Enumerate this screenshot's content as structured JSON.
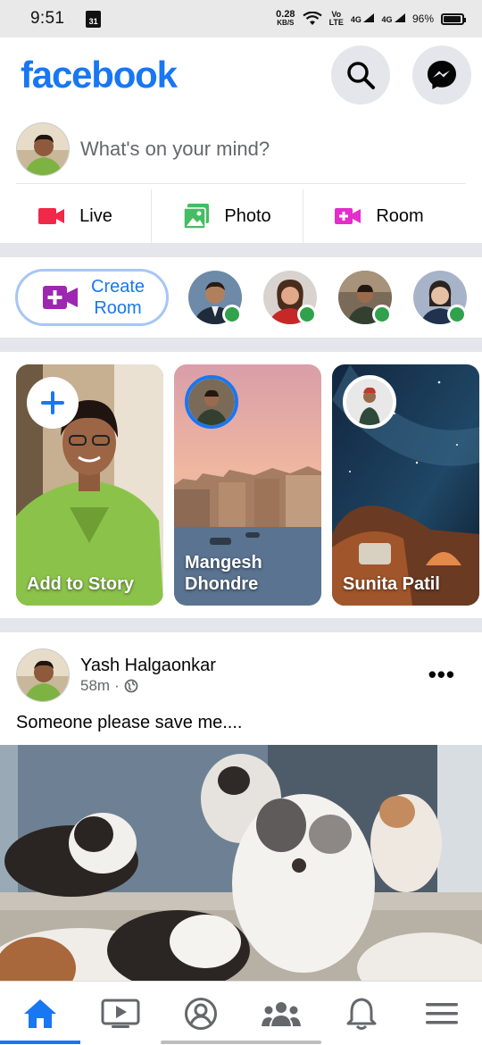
{
  "status_bar": {
    "time": "9:51",
    "calendar_day": "31",
    "net_speed": "0.28",
    "net_unit": "KB/S",
    "volte": "Vo\nLTE",
    "signal1": "4G",
    "signal2": "4G",
    "battery": "96%"
  },
  "header": {
    "logo": "facebook",
    "search_icon": "search-icon",
    "messenger_icon": "messenger-icon"
  },
  "composer": {
    "placeholder": "What's on your mind?"
  },
  "actions": [
    {
      "label": "Live",
      "icon": "video-camera-icon",
      "color": "#f02849"
    },
    {
      "label": "Photo",
      "icon": "photo-icon",
      "color": "#45bd62"
    },
    {
      "label": "Room",
      "icon": "video-plus-icon",
      "color": "#e42dcb"
    }
  ],
  "rooms": {
    "create_label": "Create\nRoom"
  },
  "stories": [
    {
      "label": "Add to Story"
    },
    {
      "label": "Mangesh\nDhondre"
    },
    {
      "label": "Sunita Patil"
    }
  ],
  "post": {
    "author": "Yash Halgaonkar",
    "time": "58m",
    "separator": "·",
    "privacy_icon": "globe-icon",
    "text": "Someone please save me...."
  },
  "nav": {
    "items": [
      "home-icon",
      "watch-icon",
      "profile-icon",
      "groups-icon",
      "notifications-icon",
      "menu-icon"
    ],
    "active": "home-icon"
  },
  "colors": {
    "brand": "#1877f2",
    "online": "#31a24c"
  }
}
